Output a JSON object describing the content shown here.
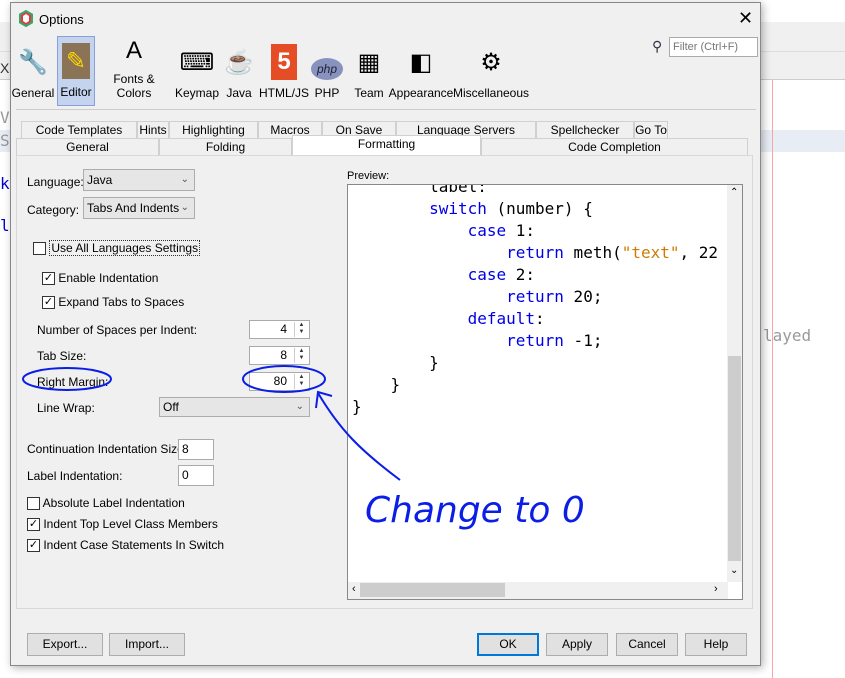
{
  "background": {
    "fragments": [
      "V",
      "S",
      "k",
      "l",
      "layed",
      "X"
    ]
  },
  "dialog": {
    "title": "Options",
    "close_icon": "close-icon",
    "filter_placeholder": "Filter (Ctrl+F)",
    "categories": [
      {
        "label": "General",
        "icon": "gear-wrench-icon"
      },
      {
        "label": "Editor",
        "icon": "editor-pencil-icon",
        "selected": true
      },
      {
        "label": "Fonts & Colors",
        "icon": "fonts-colors-icon"
      },
      {
        "label": "Keymap",
        "icon": "keyboard-icon"
      },
      {
        "label": "Java",
        "icon": "java-cup-icon"
      },
      {
        "label": "HTML/JS",
        "icon": "html5-icon"
      },
      {
        "label": "PHP",
        "icon": "php-icon"
      },
      {
        "label": "Team",
        "icon": "team-cubes-icon"
      },
      {
        "label": "Appearance",
        "icon": "appearance-icon"
      },
      {
        "label": "Miscellaneous",
        "icon": "miscellaneous-icon"
      }
    ],
    "tabs_row1": [
      "Code Templates",
      "Hints",
      "Highlighting",
      "Macros",
      "On Save",
      "Language Servers",
      "Spellchecker",
      "Go To"
    ],
    "tabs_row2": [
      "General",
      "Folding",
      "Formatting",
      "Code Completion"
    ],
    "active_tab": "Formatting",
    "form": {
      "language_label": "Language:",
      "language_value": "Java",
      "category_label": "Category:",
      "category_value": "Tabs And Indents",
      "use_all_languages": {
        "label": "Use All Languages Settings",
        "checked": false
      },
      "enable_indentation": {
        "label": "Enable Indentation",
        "checked": true
      },
      "expand_tabs": {
        "label": "Expand Tabs to Spaces",
        "checked": true
      },
      "spaces_per_indent_label": "Number of Spaces per Indent:",
      "spaces_per_indent": "4",
      "tab_size_label": "Tab Size:",
      "tab_size": "8",
      "right_margin_label": "Right Margin:",
      "right_margin": "80",
      "line_wrap_label": "Line Wrap:",
      "line_wrap": "Off",
      "continuation_label": "Continuation Indentation Size:",
      "continuation": "8",
      "label_indentation_label": "Label Indentation:",
      "label_indentation": "0",
      "absolute_label": {
        "label": "Absolute Label Indentation",
        "checked": false
      },
      "indent_top_level": {
        "label": "Indent Top Level Class Members",
        "checked": true
      },
      "indent_case": {
        "label": "Indent Case Statements In Switch",
        "checked": true
      }
    },
    "preview": {
      "label": "Preview:",
      "lines": [
        {
          "indent": 2,
          "parts": [
            {
              "t": "label:",
              "c": "plain"
            }
          ]
        },
        {
          "indent": 2,
          "parts": [
            {
              "t": "switch",
              "c": "kw"
            },
            {
              "t": " (number) {",
              "c": "plain"
            }
          ]
        },
        {
          "indent": 3,
          "parts": [
            {
              "t": "case",
              "c": "kw"
            },
            {
              "t": " 1:",
              "c": "plain"
            }
          ]
        },
        {
          "indent": 4,
          "parts": [
            {
              "t": "return",
              "c": "kw"
            },
            {
              "t": " meth(",
              "c": "plain"
            },
            {
              "t": "\"text\"",
              "c": "str"
            },
            {
              "t": ", 22",
              "c": "plain"
            }
          ]
        },
        {
          "indent": 3,
          "parts": [
            {
              "t": "case",
              "c": "kw"
            },
            {
              "t": " 2:",
              "c": "plain"
            }
          ]
        },
        {
          "indent": 4,
          "parts": [
            {
              "t": "return",
              "c": "kw"
            },
            {
              "t": " 20;",
              "c": "plain"
            }
          ]
        },
        {
          "indent": 3,
          "parts": [
            {
              "t": "default",
              "c": "kw"
            },
            {
              "t": ":",
              "c": "plain"
            }
          ]
        },
        {
          "indent": 4,
          "parts": [
            {
              "t": "return",
              "c": "kw"
            },
            {
              "t": " -1;",
              "c": "plain"
            }
          ]
        },
        {
          "indent": 2,
          "parts": [
            {
              "t": "}",
              "c": "plain"
            }
          ]
        },
        {
          "indent": 1,
          "parts": [
            {
              "t": "}",
              "c": "plain"
            }
          ]
        },
        {
          "indent": 0,
          "parts": [
            {
              "t": "}",
              "c": "plain"
            }
          ]
        }
      ]
    },
    "buttons": {
      "export": "Export...",
      "import": "Import...",
      "ok": "OK",
      "apply": "Apply",
      "cancel": "Cancel",
      "help": "Help"
    }
  },
  "annotation": {
    "text": "Change to 0",
    "color": "#0a1ee6"
  },
  "colors": {
    "keyword": "#0000e6",
    "string": "#ce7b00",
    "selection": "#c4d4ef",
    "default_button_border": "#0078d7"
  }
}
